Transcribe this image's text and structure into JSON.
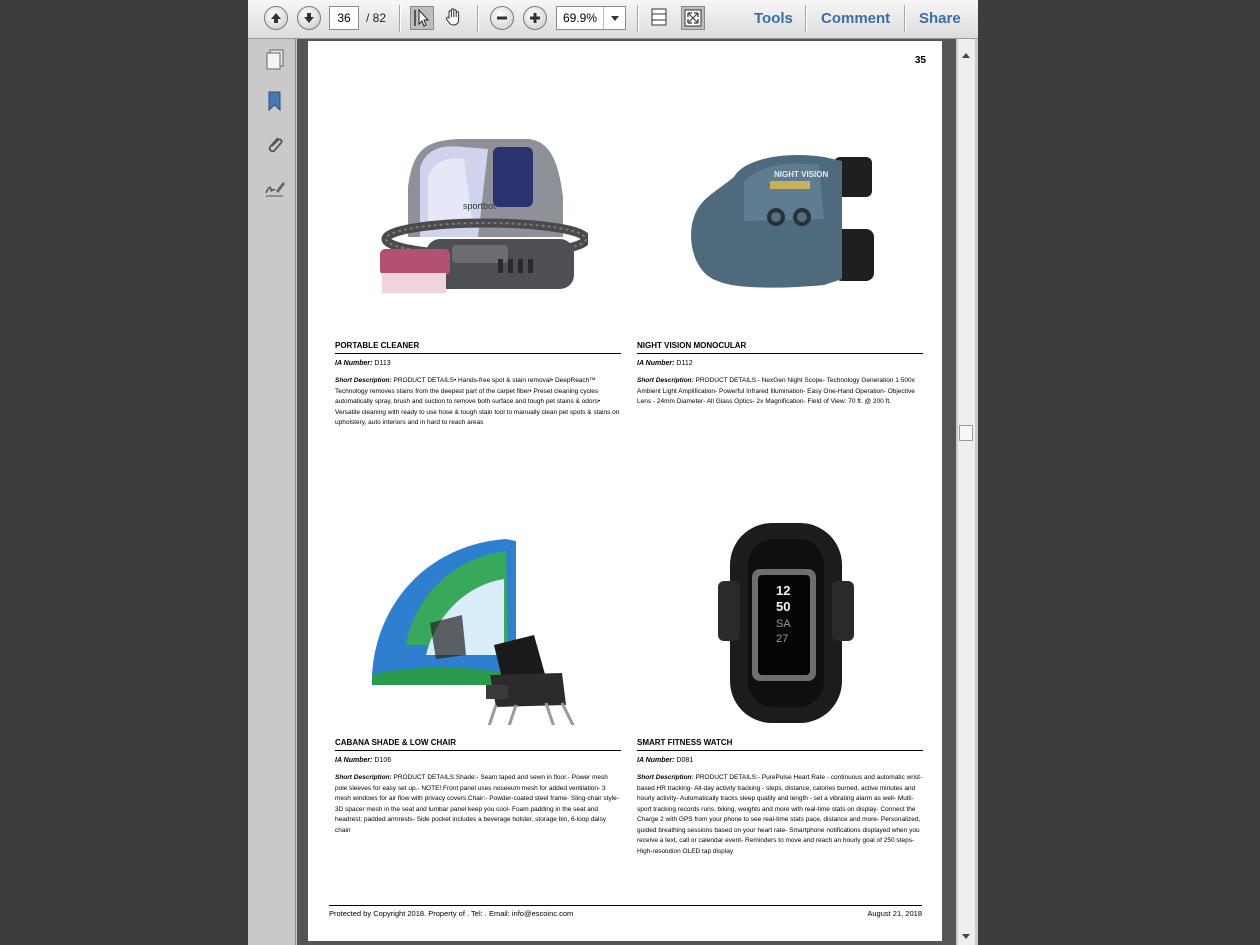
{
  "toolbar": {
    "current_page": "36",
    "page_total": "/ 82",
    "zoom": "69.9%",
    "tools_label": "Tools",
    "comment_label": "Comment",
    "share_label": "Share"
  },
  "page": {
    "number": "35",
    "products": [
      {
        "name": "PORTABLE CLEANER",
        "ia_label": "IA Number:",
        "ia_number": "D113",
        "desc_label": "Short Description:",
        "description": "PRODUCT DETAILS• Hands-free spot & stain removal• DeepReach™ Technology removes stains from the deepest part of the carpet fiber• Preset cleaning cycles automatically spray, brush and suction to remove both surface and tough pet stains & odors• Versatile cleaning with ready to use hose & tough stain tool to manually clean pet spots & stains on upholstery, auto interiors and in hard to reach areas"
      },
      {
        "name": "NIGHT VISION MONOCULAR",
        "ia_label": "IA Number:",
        "ia_number": "D112",
        "desc_label": "Short Description:",
        "description": "PRODUCT DETAILS:- NexGen Night Scope- Technology Generation 1 500x Ambient Light Amplification- Powerful Infrared Illumination- Easy One-Hand Operation- Objective Lens - 24mm Diameter- All Glass Optics- 2x Magnification- Field of View: 70 ft. @ 200 ft."
      },
      {
        "name": "CABANA SHADE & LOW CHAIR",
        "ia_label": "IA Number:",
        "ia_number": "D106",
        "desc_label": "Short Description:",
        "description": "PRODUCT DETAILS:Shade:- Seam taped and sewn in floor.- Power mesh pole sleeves for easy set up.- NOTE! Front panel uses noseeum mesh for added ventilation- 3 mesh windows for air flow with privacy covers.Chair:- Powder-coated steel frame- Sling-chair style- 3D spacer mesh in the seat and lumbar panel keep you cool- Foam padding in the seat and headrest; padded armrests- Side pocket includes a beverage holster, storage bin, 6-loop daisy chain"
      },
      {
        "name": "SMART FITNESS WATCH",
        "ia_label": "IA Number:",
        "ia_number": "D081",
        "desc_label": "Short Description:",
        "description": "PRODUCT DETAILS:- PurePulse Heart Rate - continuous and automatic wrist-based HR tracking- All-day activity tracking - steps, distance, calories burned, active minutes and hourly activity- Automatically tracks sleep quality and length - set a vibrating alarm as well- Multi-sport tracking records runs, biking, weights and more with real-time stats on display- Connect the Charge 2 with GPS from your phone to see real-time stats pace, distance and more- Personalized, guided breathing sessions based on your heart rate- Smartphone notifications displayed when you receive a text, call or calendar event- Reminders to move and reach an hourly goal of 250 steps- High-resolution OLED tap display"
      }
    ],
    "images": {
      "cleaner_brand": "sportbot",
      "monocular_text": "NIGHT VISION",
      "watch_time_top": "12",
      "watch_time_mid": "50",
      "watch_day": "SA",
      "watch_date": "27"
    },
    "footer_left": "Protected by Copyright 2018. Property of .  Tel: . Email: info@escoinc.com",
    "footer_right": "August 21, 2018"
  }
}
